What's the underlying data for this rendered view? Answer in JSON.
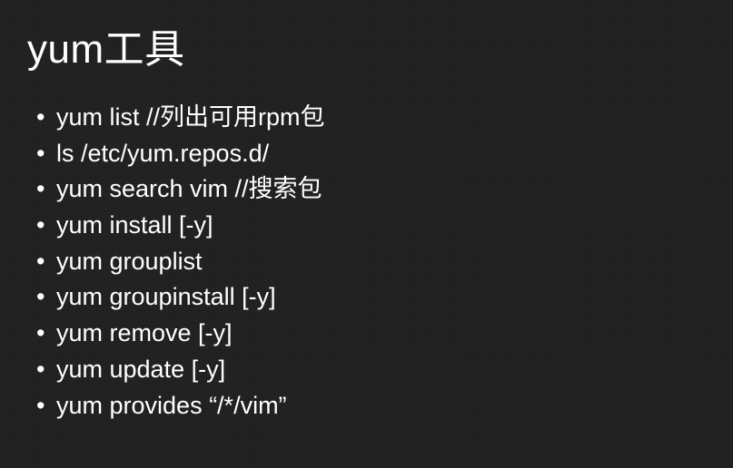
{
  "title": "yum工具",
  "items": [
    "yum list  //列出可用rpm包",
    "ls /etc/yum.repos.d/",
    "yum search vim  //搜索包",
    "yum install [-y]",
    "yum grouplist",
    "yum groupinstall  [-y]",
    "yum remove [-y]",
    "yum update [-y]",
    "yum provides  “/*/vim”"
  ]
}
